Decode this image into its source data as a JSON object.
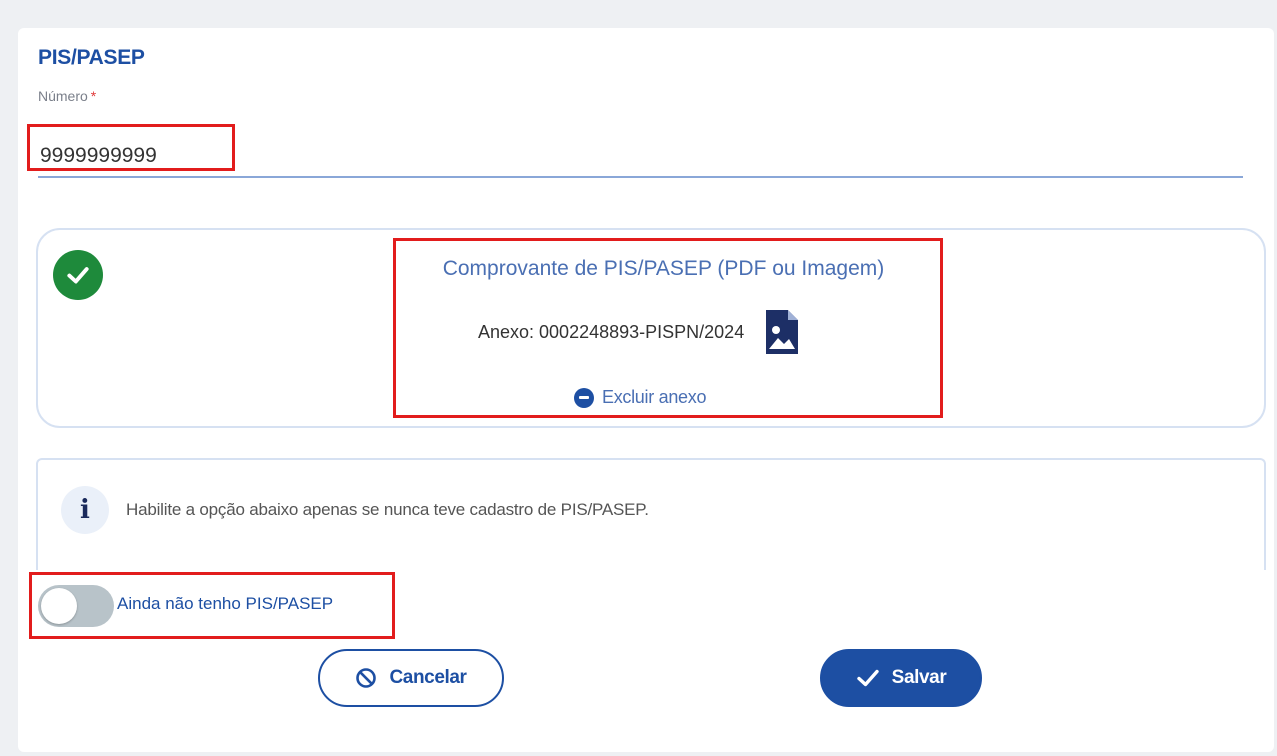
{
  "section": {
    "title": "PIS/PASEP",
    "number_label": "Número",
    "required_mark": "*",
    "number_value": "9999999999"
  },
  "attachment": {
    "title": "Comprovante de PIS/PASEP (PDF ou Imagem)",
    "file_label": "Anexo: 0002248893-PISPN/2024",
    "remove_label": "Excluir anexo"
  },
  "info": {
    "text": "Habilite a opção abaixo apenas se nunca teve cadastro de PIS/PASEP.",
    "icon_glyph": "i"
  },
  "toggle": {
    "label": "Ainda não tenho PIS/PASEP",
    "checked": false
  },
  "actions": {
    "cancel_label": "Cancelar",
    "save_label": "Salvar"
  },
  "colors": {
    "primary": "#1d4fa3",
    "success": "#1e8a3b",
    "highlight": "#e21c1c",
    "toggle_off": "#b8c3c9"
  },
  "icons": {
    "success": "check-circle-icon",
    "document": "image-file-icon",
    "remove": "minus-circle-icon",
    "info": "info-icon",
    "cancel": "prohibit-icon",
    "save": "checkmark-icon"
  }
}
